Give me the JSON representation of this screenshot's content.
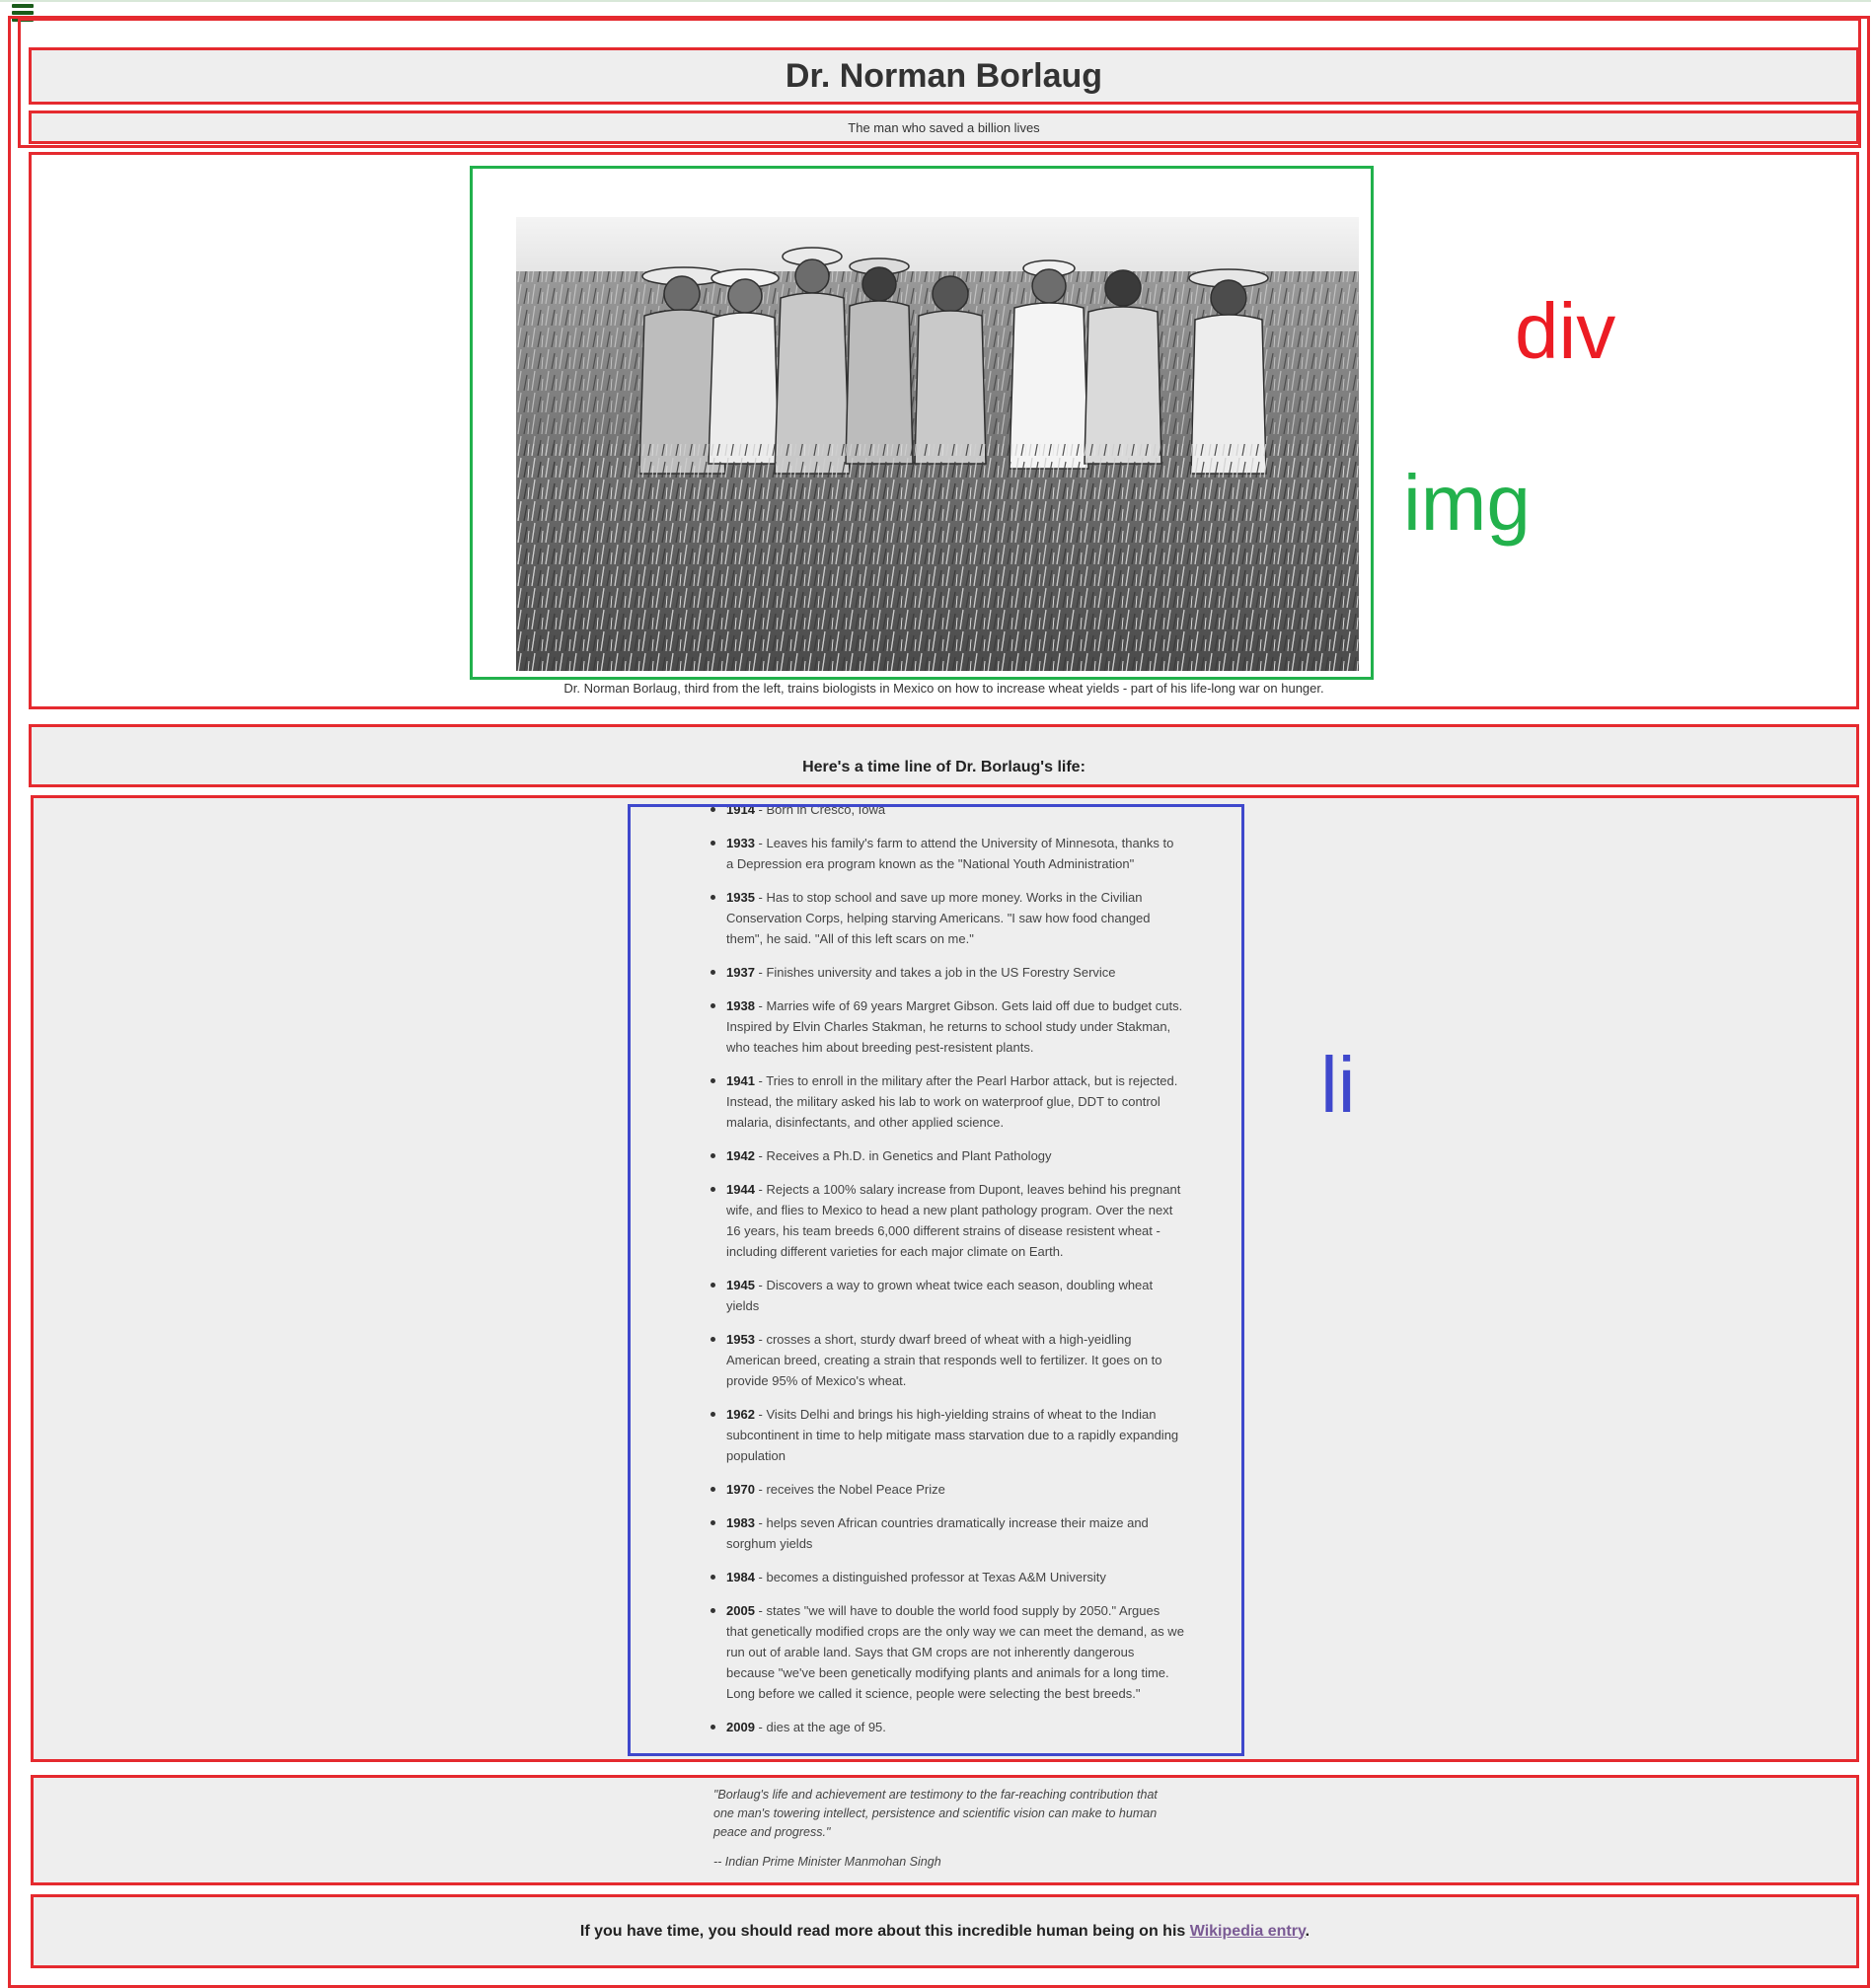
{
  "header": {
    "title": "Dr. Norman Borlaug",
    "subtitle": "The man who saved a billion lives"
  },
  "image": {
    "caption": "Dr. Norman Borlaug, third from the left, trains biologists in Mexico on how to increase wheat yields - part of his life-long war on hunger."
  },
  "annotations": {
    "div_label": "div",
    "img_label": "img",
    "li_label": "li",
    "colors": {
      "div": "#ec1c24",
      "img": "#22b14c",
      "li": "#3f48cc"
    }
  },
  "timeline": {
    "heading": "Here's a time line of Dr. Borlaug's life:",
    "items": [
      {
        "year": "1914",
        "text": " - Born in Cresco, Iowa"
      },
      {
        "year": "1933",
        "text": " - Leaves his family's farm to attend the University of Minnesota, thanks to a Depression era program known as the \"National Youth Administration\""
      },
      {
        "year": "1935",
        "text": " - Has to stop school and save up more money. Works in the Civilian Conservation Corps, helping starving Americans. \"I saw how food changed them\", he said. \"All of this left scars on me.\""
      },
      {
        "year": "1937",
        "text": " - Finishes university and takes a job in the US Forestry Service"
      },
      {
        "year": "1938",
        "text": " - Marries wife of 69 years Margret Gibson. Gets laid off due to budget cuts. Inspired by Elvin Charles Stakman, he returns to school study under Stakman, who teaches him about breeding pest-resistent plants."
      },
      {
        "year": "1941",
        "text": " - Tries to enroll in the military after the Pearl Harbor attack, but is rejected. Instead, the military asked his lab to work on waterproof glue, DDT to control malaria, disinfectants, and other applied science."
      },
      {
        "year": "1942",
        "text": " - Receives a Ph.D. in Genetics and Plant Pathology"
      },
      {
        "year": "1944",
        "text": " - Rejects a 100% salary increase from Dupont, leaves behind his pregnant wife, and flies to Mexico to head a new plant pathology program. Over the next 16 years, his team breeds 6,000 different strains of disease resistent wheat - including different varieties for each major climate on Earth."
      },
      {
        "year": "1945",
        "text": " - Discovers a way to grown wheat twice each season, doubling wheat yields"
      },
      {
        "year": "1953",
        "text": " - crosses a short, sturdy dwarf breed of wheat with a high-yeidling American breed, creating a strain that responds well to fertilizer. It goes on to provide 95% of Mexico's wheat."
      },
      {
        "year": "1962",
        "text": " - Visits Delhi and brings his high-yielding strains of wheat to the Indian subcontinent in time to help mitigate mass starvation due to a rapidly expanding population"
      },
      {
        "year": "1970",
        "text": " - receives the Nobel Peace Prize"
      },
      {
        "year": "1983",
        "text": " - helps seven African countries dramatically increase their maize and sorghum yields"
      },
      {
        "year": "1984",
        "text": " - becomes a distinguished professor at Texas A&M University"
      },
      {
        "year": "2005",
        "text": " - states \"we will have to double the world food supply by 2050.\" Argues that genetically modified crops are the only way we can meet the demand, as we run out of arable land. Says that GM crops are not inherently dangerous because \"we've been genetically modifying plants and animals for a long time. Long before we called it science, people were selecting the best breeds.\""
      },
      {
        "year": "2009",
        "text": " - dies at the age of 95."
      }
    ]
  },
  "quote": {
    "text": "\"Borlaug's life and achievement are testimony to the far-reaching contribution that one man's towering intellect, persistence and scientific vision can make to human peace and progress.\"",
    "author": "-- Indian Prime Minister Manmohan Singh"
  },
  "footer": {
    "text_before": "If you have time, you should read more about this incredible human being on his ",
    "link_text": "Wikipedia entry",
    "text_after": "."
  }
}
